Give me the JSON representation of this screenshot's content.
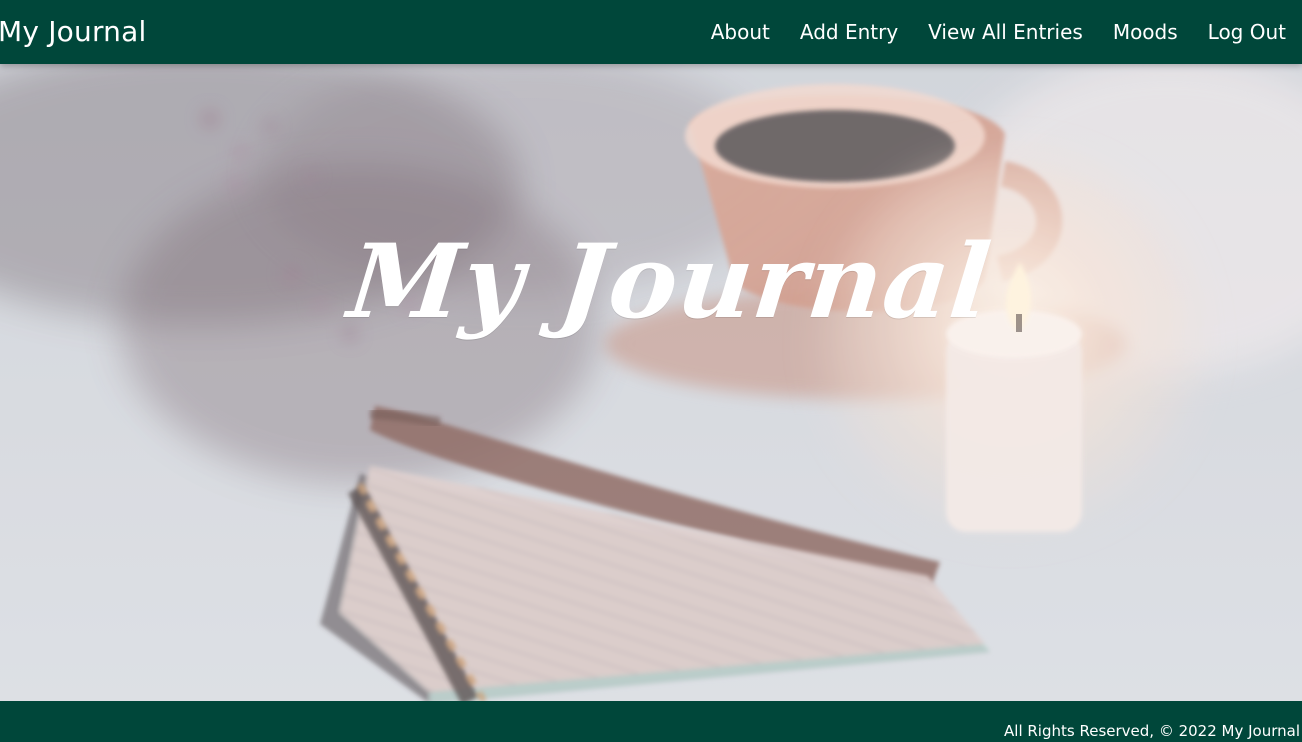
{
  "header": {
    "brand": "My Journal",
    "nav": [
      {
        "label": "About"
      },
      {
        "label": "Add Entry"
      },
      {
        "label": "View All Entries"
      },
      {
        "label": "Moods"
      },
      {
        "label": "Log Out"
      }
    ],
    "bg_color": "#00473a"
  },
  "hero": {
    "title": "My Journal",
    "image_name": "notebook-pen-coffee-candle-photo",
    "overlay_color": "rgba(255,255,255,0.2)"
  },
  "footer": {
    "text": "All Rights Reserved, © 2022 My Journal",
    "bg_color": "#00473a"
  }
}
